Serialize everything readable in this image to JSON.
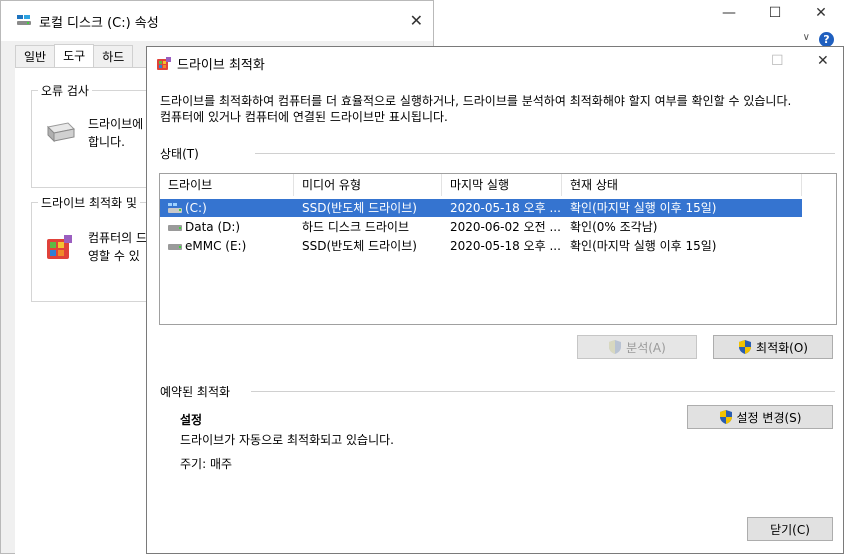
{
  "background_window": {
    "controls": [
      "—",
      "☐",
      "✕"
    ],
    "help_glyph": "?",
    "chevron": "∨"
  },
  "properties": {
    "title": "로컬 디스크 (C:) 속성",
    "tabs": [
      "일반",
      "도구",
      "하드"
    ],
    "active_tab": "도구",
    "error_check": {
      "label": "오류 검사",
      "text_line1": "드라이브에",
      "text_line2": "합니다."
    },
    "optimize_group": {
      "label": "드라이브 최적화 및",
      "text_line1": "컴퓨터의 드",
      "text_line2": "영할 수 있"
    }
  },
  "optimizer": {
    "title": "드라이브 최적화",
    "description": "드라이브를 최적화하여 컴퓨터를 더 효율적으로 실행하거나, 드라이브를 분석하여 최적화해야 할지 여부를 확인할 수 있습니다. 컴퓨터에 있거나 컴퓨터에 연결된 드라이브만 표시됩니다.",
    "status_label": "상태(T)",
    "columns": [
      "드라이브",
      "미디어 유형",
      "마지막 실행",
      "현재 상태"
    ],
    "drives": [
      {
        "name": "(C:)",
        "media": "SSD(반도체 드라이브)",
        "last_run": "2020-05-18 오후 ...",
        "status": "확인(마지막 실행 이후 15일)",
        "selected": true
      },
      {
        "name": "Data (D:)",
        "media": "하드 디스크 드라이브",
        "last_run": "2020-06-02 오전 ...",
        "status": "확인(0% 조각남)",
        "selected": false
      },
      {
        "name": "eMMC (E:)",
        "media": "SSD(반도체 드라이브)",
        "last_run": "2020-05-18 오후 ...",
        "status": "확인(마지막 실행 이후 15일)",
        "selected": false
      }
    ],
    "analyze_button": "분석(A)",
    "optimize_button": "최적화(O)",
    "scheduled_label": "예약된 최적화",
    "settings_heading": "설정",
    "settings_status": "드라이브가 자동으로 최적화되고 있습니다.",
    "frequency": "주기: 매주",
    "change_settings_button": "설정 변경(S)",
    "close_button": "닫기(C)",
    "window_controls": [
      "☐",
      "✕"
    ]
  },
  "colors": {
    "selection": "#3574d0",
    "shield_blue": "#2a5db0",
    "shield_yellow": "#f2c200"
  }
}
